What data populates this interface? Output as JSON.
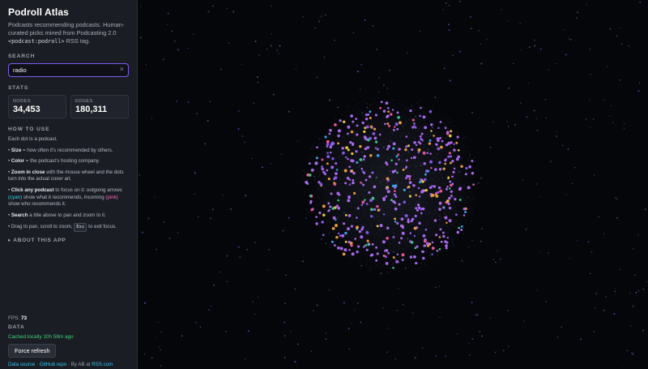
{
  "app": {
    "title": "Podroll Atlas",
    "subtitle_text": "Podcasts recommending podcasts. Human-curated picks mined from Podcasting 2.0",
    "subtitle_code": "<podcast:podroll>",
    "subtitle_tail": " RSS tag."
  },
  "search": {
    "label": "SEARCH",
    "value": "radio",
    "clear_icon": "×"
  },
  "stats": {
    "label": "STATS",
    "nodes_label": "NODES",
    "nodes_value": "34,453",
    "edges_label": "EDGES",
    "edges_value": "180,311"
  },
  "howto": {
    "label": "HOW TO USE",
    "intro": "Each dot is a podcast.",
    "size_term": "Size",
    "size_text": " = how often it's recommended by others.",
    "color_term": "Color",
    "color_text": " = the podcast's hosting company.",
    "zoom_term": "Zoom in close",
    "zoom_text": " with the mouse wheel and the dots turn into the actual cover art.",
    "click_term": "Click any podcast",
    "click_text_1": " to focus on it: outgoing arrows ",
    "cyan_word": "(cyan)",
    "click_text_2": " show what it recommends, incoming ",
    "pink_word": "(pink)",
    "click_text_3": " show who recommends it.",
    "search_term": "Search",
    "search_text": " a title above to pan and zoom to it.",
    "drag_text": "Drag to pan, scroll to zoom,",
    "esc_key": "Esc",
    "drag_tail": "to exit focus."
  },
  "about": {
    "label": "▸ ABOUT THIS APP"
  },
  "status": {
    "fps_label": "FPS:",
    "fps_value": "73",
    "data_label": "DATA",
    "cached": "Cached locally 10h 58m ago",
    "refresh_button": "Force refresh"
  },
  "footer": {
    "data_source": "Data source",
    "sep1": " · ",
    "github": "GitHub repo",
    "sep2": " · By AB at ",
    "rss": "RSS.com"
  },
  "colors": {
    "accent": "#7a5cf0",
    "cyan": "#39d0f0",
    "pink": "#f06ab8",
    "cached": "#3fd077",
    "dot_palette": [
      "#b06cf5",
      "#8c5cf0",
      "#f0a33a",
      "#f05a9a",
      "#3ecf8e",
      "#3aa6f0",
      "#f0d040",
      "#e05050"
    ]
  }
}
